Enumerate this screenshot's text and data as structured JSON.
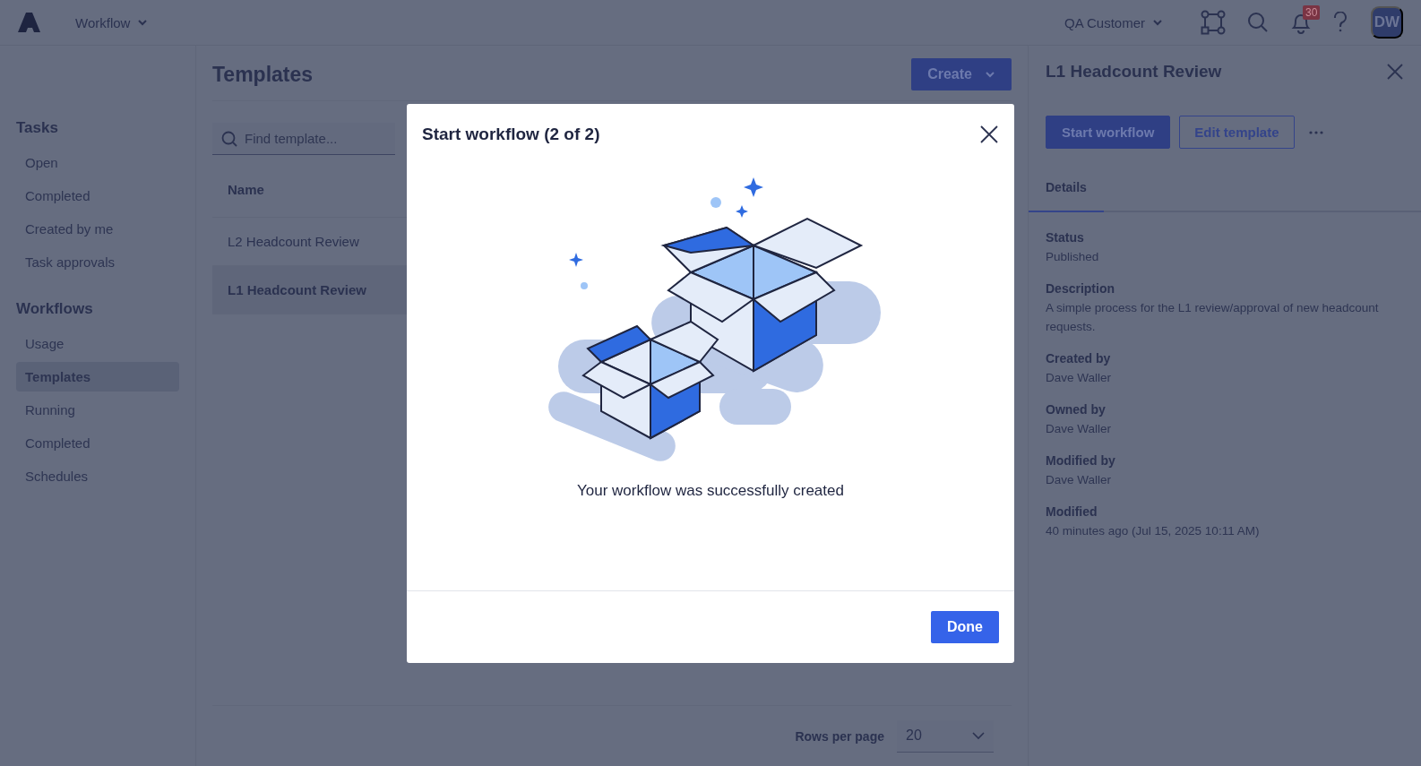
{
  "header": {
    "app_menu": "Workflow",
    "account_menu": "QA Customer",
    "notification_count": "30",
    "avatar_initials": "DW"
  },
  "sidebar": {
    "sections": [
      {
        "title": "Tasks",
        "items": [
          {
            "label": "Open",
            "selected": false
          },
          {
            "label": "Completed",
            "selected": false
          },
          {
            "label": "Created by me",
            "selected": false
          },
          {
            "label": "Task approvals",
            "selected": false
          }
        ]
      },
      {
        "title": "Workflows",
        "items": [
          {
            "label": "Usage",
            "selected": false
          },
          {
            "label": "Templates",
            "selected": true
          },
          {
            "label": "Running",
            "selected": false
          },
          {
            "label": "Completed",
            "selected": false
          },
          {
            "label": "Schedules",
            "selected": false
          }
        ]
      }
    ]
  },
  "main": {
    "title": "Templates",
    "create_button": "Create",
    "search": {
      "placeholder": "Find template..."
    },
    "table": {
      "columns": [
        "Name"
      ],
      "rows": [
        {
          "name": "L2 Headcount Review",
          "selected": false
        },
        {
          "name": "L1 Headcount Review",
          "selected": true
        }
      ]
    },
    "rows_per_page": {
      "label": "Rows per page",
      "value": "20"
    }
  },
  "detail_panel": {
    "title": "L1 Headcount Review",
    "primary_button": "Start workflow",
    "secondary_button": "Edit template",
    "tabs": [
      {
        "label": "Details",
        "selected": true
      }
    ],
    "fields": [
      {
        "label": "Status",
        "value": "Published"
      },
      {
        "label": "Description",
        "value": "A simple process for the L1 review/approval of new headcount requests."
      },
      {
        "label": "Created by",
        "value": "Dave Waller"
      },
      {
        "label": "Owned by",
        "value": "Dave Waller"
      },
      {
        "label": "Modified by",
        "value": "Dave Waller"
      },
      {
        "label": "Modified",
        "value": "40 minutes ago (Jul 15, 2025 10:11 AM)"
      }
    ]
  },
  "modal": {
    "title": "Start workflow (2 of 2)",
    "message": "Your workflow was successfully created",
    "done_button": "Done"
  }
}
